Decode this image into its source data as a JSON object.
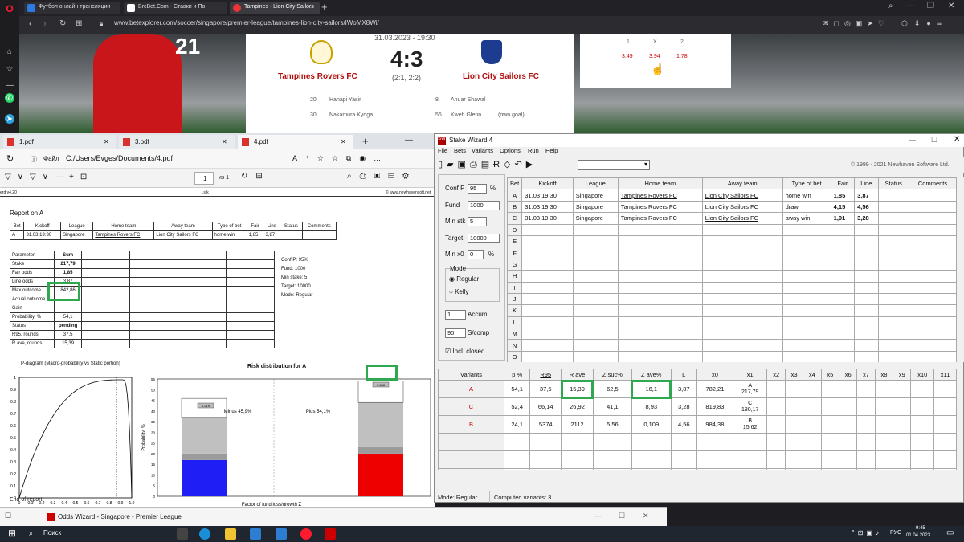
{
  "browser": {
    "tabs": [
      {
        "title": "Футбол онлайн трансляции"
      },
      {
        "title": "BrcBet.Com - Ставки и По"
      },
      {
        "title": "Tampines - Lion City Sailors"
      }
    ],
    "url": "www.betexplorer.com/soccer/singapore/premier-league/tampines-lion-city-sailors/IWoMX8Wi/"
  },
  "match": {
    "date": "31.03.2023 - 19:30",
    "home": "Tampines Rovers FC",
    "away": "Lion City Sailors FC",
    "score": "4:3",
    "halftime": "(2:1, 2:2)",
    "player_number": "21",
    "events": [
      {
        "hmin": "20.",
        "hname": "Hanapi Yasir",
        "amin": "8.",
        "aname": "Anuar Shawal",
        "note": ""
      },
      {
        "hmin": "30.",
        "hname": "Nakamura Kyoga",
        "amin": "56.",
        "aname": "Kweh Glenn",
        "note": "(own goal)"
      }
    ]
  },
  "odds": {
    "headers": [
      "1",
      "X",
      "2"
    ],
    "values": [
      "3.49",
      "3.94",
      "1.78"
    ]
  },
  "pdf": {
    "tabs": [
      {
        "title": "1.pdf"
      },
      {
        "title": "3.pdf"
      },
      {
        "title": "4.pdf"
      }
    ],
    "file_label": "Файл",
    "path": "C:/Users/Evges/Documents/4.pdf",
    "page_num": "1",
    "page_of": "из 1",
    "header_left": "erd v4.20",
    "header_mid": ".stk",
    "header_right": "© www.newhavensoft.net",
    "report_title": "Report on A",
    "bet_headers": [
      "Bet",
      "Kickoff",
      "League",
      "Home team",
      "Away team",
      "Type of bet",
      "Fair",
      "Line",
      "Status",
      "Comments"
    ],
    "bet_row": [
      "A",
      "31.03 19:30",
      "Singapore",
      "Tampines Rovers FC",
      "Lion City Sailors FC",
      "home win",
      "1,85",
      "3,87",
      "",
      ""
    ],
    "param_headers": [
      "Parameter",
      "Sum"
    ],
    "params": [
      [
        "Stake",
        "217,79"
      ],
      [
        "Fair odds",
        "1,85"
      ],
      [
        "Line odds",
        "3,87"
      ],
      [
        "Max outcome",
        "842,86"
      ],
      [
        "Actual outcome",
        ""
      ],
      [
        "Gain",
        ""
      ],
      [
        "Probability, %",
        "54,1"
      ],
      [
        "Status",
        "pending"
      ],
      [
        "R95, rounds",
        "37,5"
      ],
      [
        "R ave, rounds",
        "15,39"
      ]
    ],
    "settings": [
      "Conf P: 95%",
      "Fund: 1000",
      "Min stake: 5",
      "Target: 10000",
      "Mode: Regular"
    ],
    "pdiag_title": "P-diagram (Macro-probability vs Static portion)",
    "pdiag_yticks": [
      "1",
      "0.9",
      "0.8",
      "0.7",
      "0.6",
      "0.5",
      "0.4",
      "0.3",
      "0.2",
      "0.1",
      "0"
    ],
    "pdiag_xticks": [
      "0",
      "0.1",
      "0.2",
      "0.3",
      "0.4",
      "0.5",
      "0.6",
      "0.7",
      "0.8",
      "0.9",
      "1.0"
    ],
    "risk_title": "Risk distribution for A",
    "risk_yticks": [
      "55",
      "50",
      "45",
      "40",
      "35",
      "30",
      "25",
      "20",
      "15",
      "10",
      "5",
      "0"
    ],
    "risk_ylabel": "Probability, %",
    "risk_xlabel": "Factor of fund loss/growth Z",
    "minus_label": "Minus 45,9%",
    "plus_label": "Plus 54,1%",
    "small_left": "0.219",
    "small_right": "3.868",
    "end": "End of report",
    "chart_data": {
      "type": "bar",
      "title": "Risk distribution for A",
      "categories": [
        "Minus",
        "Plus"
      ],
      "series": [
        {
          "values": [
            17,
            20
          ]
        },
        {
          "values": [
            3,
            3
          ]
        },
        {
          "values": [
            17,
            21
          ]
        },
        {
          "values": [
            8.9,
            10.1
          ]
        }
      ],
      "ylim": [
        0,
        55
      ]
    }
  },
  "sw": {
    "title": "Stake Wizard 4",
    "copyright": "© 1999 - 2021 Newhaven Software Ltd.",
    "menu": [
      "File",
      "Bets",
      "Variants",
      "Options",
      "Run",
      "Help"
    ],
    "conf_label": "Conf P",
    "conf_val": "95",
    "pct": "%",
    "fund_label": "Fund",
    "fund_val": "1000",
    "minstk_label": "Min stk",
    "minstk_val": "5",
    "target_label": "Target",
    "target_val": "10000",
    "minx0_label": "Min x0",
    "minx0_val": "0",
    "mode_label": "Mode",
    "mode_regular": "Regular",
    "mode_kelly": "Kelly",
    "accum_val": "1",
    "accum_label": "Accum",
    "scomp_val": "90",
    "scomp_label": "S/comp",
    "incl_label": "Incl. closed",
    "bet_headers": [
      "Bet",
      "Kickoff",
      "League",
      "Home team",
      "Away team",
      "Type of bet",
      "Fair",
      "Line",
      "Status",
      "Comments"
    ],
    "bets": [
      [
        "A",
        "31.03 19:30",
        "Singapore",
        "Tampines Rovers FC",
        "Lion City Sailors FC",
        "home win",
        "1,85",
        "3,87",
        "",
        ""
      ],
      [
        "B",
        "31.03 19:30",
        "Singapore",
        "Tampines Rovers FC",
        "Lion City Sailors FC",
        "draw",
        "4,15",
        "4,56",
        "",
        ""
      ],
      [
        "C",
        "31.03 19:30",
        "Singapore",
        "Tampines Rovers FC",
        "Lion City Sailors FC",
        "away win",
        "1,91",
        "3,28",
        "",
        ""
      ],
      [
        "D"
      ],
      [
        "E"
      ],
      [
        "F"
      ],
      [
        "G"
      ],
      [
        "H"
      ],
      [
        "I"
      ],
      [
        "J"
      ],
      [
        "K"
      ],
      [
        "L"
      ],
      [
        "M"
      ],
      [
        "N"
      ],
      [
        "O"
      ]
    ],
    "var_headers": [
      "Variants",
      "p %",
      "R95",
      "R ave",
      "Z suc%",
      "Z ave%",
      "L",
      "x0",
      "x1",
      "x2",
      "x3",
      "x4",
      "x5",
      "x6",
      "x7",
      "x8",
      "x9",
      "x10",
      "x11"
    ],
    "variants": [
      {
        "name": "A",
        "p": "54,1",
        "r95": "37,5",
        "rave": "15,39",
        "zsuc": "62,5",
        "zave": "16,1",
        "l": "3,87",
        "x0": "782,21",
        "x1a": "A",
        "x1b": "217,79"
      },
      {
        "name": "C",
        "p": "52,4",
        "r95": "66,14",
        "rave": "26,92",
        "zsuc": "41,1",
        "zave": "8,93",
        "l": "3,28",
        "x0": "819,83",
        "x1a": "C",
        "x1b": "180,17"
      },
      {
        "name": "B",
        "p": "24,1",
        "r95": "5374",
        "rave": "2112",
        "zsuc": "5,56",
        "zave": "0,109",
        "l": "4,56",
        "x0": "984,38",
        "x1a": "B",
        "x1b": "15,62"
      }
    ],
    "status_mode": "Mode: Regular",
    "status_computed": "Computed variants: 3"
  },
  "oddswiz": {
    "title": "Odds Wizard - Singapore - Premier League"
  },
  "taskbar": {
    "search": "Поиск",
    "lang": "РУС",
    "time": "9:45",
    "date": "01.04.2023"
  },
  "colors": {
    "green_highlight": "#2fa84f",
    "opera_red": "#ff1b2d",
    "minus_bar": "#1f1ff5",
    "plus_bar": "#ee0000"
  }
}
